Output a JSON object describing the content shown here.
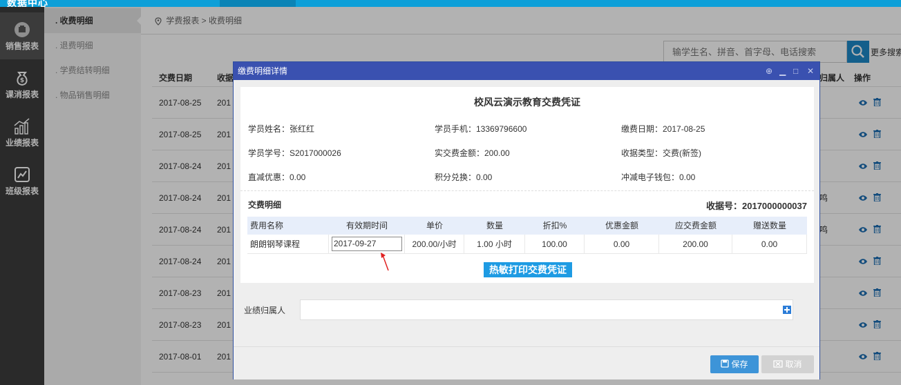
{
  "app": {
    "title": "数据中心"
  },
  "sidebar": {
    "items": [
      {
        "label": "销售报表",
        "icon": "sales-report-icon"
      },
      {
        "label": "课消报表",
        "icon": "money-bag-icon"
      },
      {
        "label": "业绩报表",
        "icon": "bar-chart-icon"
      },
      {
        "label": "班级报表",
        "icon": "line-chart-icon"
      }
    ]
  },
  "subnav": {
    "items": [
      {
        "label": ". 收费明细"
      },
      {
        "label": ". 退费明细"
      },
      {
        "label": ". 学费结转明细"
      },
      {
        "label": ". 物品销售明细"
      }
    ]
  },
  "breadcrumb": {
    "text": "学费报表 > 收费明细"
  },
  "search": {
    "placeholder": "输学生名、拼音、首字母、电话搜索",
    "more_label": "更多搜索"
  },
  "table": {
    "headers": {
      "date": "交费日期",
      "receipt": "收据",
      "owner": "归属人",
      "ops": "操作"
    },
    "rows": [
      {
        "date": "2017-08-25",
        "receipt": "201",
        "owner": ""
      },
      {
        "date": "2017-08-25",
        "receipt": "201",
        "owner": ""
      },
      {
        "date": "2017-08-24",
        "receipt": "201",
        "owner": ""
      },
      {
        "date": "2017-08-24",
        "receipt": "201",
        "owner": "鸣"
      },
      {
        "date": "2017-08-24",
        "receipt": "201",
        "owner": "鸣"
      },
      {
        "date": "2017-08-24",
        "receipt": "201",
        "owner": ""
      },
      {
        "date": "2017-08-23",
        "receipt": "201",
        "owner": ""
      },
      {
        "date": "2017-08-23",
        "receipt": "201",
        "owner": ""
      },
      {
        "date": "2017-08-01",
        "receipt": "201",
        "owner": ""
      }
    ]
  },
  "modal": {
    "title": "缴费明细详情",
    "receipt_title": "校风云演示教育交费凭证",
    "info": {
      "student_name": "学员姓名：张红红",
      "student_phone": "学员手机：13369796600",
      "pay_date": "缴费日期：2017-08-25",
      "student_no": "学员学号：S2017000026",
      "actual_amount": "实交费金额：200.00",
      "receipt_type": "收据类型：交费(新签)",
      "direct_discount": "直减优惠：0.00",
      "points_exchange": "积分兑换：0.00",
      "wallet_deduct": "冲减电子钱包：0.00"
    },
    "section_title": "交费明细",
    "receipt_no": "收据号：2017000000037",
    "detail_headers": [
      "费用名称",
      "有效期时间",
      "单价",
      "数量",
      "折扣%",
      "优惠金额",
      "应交费金额",
      "赠送数量"
    ],
    "detail_row": {
      "name": "朗朗钢琴课程",
      "valid_date": "2017-09-27",
      "unit_price": "200.00/小时",
      "quantity": "1.00 小时",
      "discount": "100.00",
      "discount_amount": "0.00",
      "payable": "200.00",
      "gift_qty": "0.00"
    },
    "print_label": "热敏打印交费凭证",
    "performance_label": "业绩归属人",
    "save_label": "保存",
    "cancel_label": "取消"
  }
}
